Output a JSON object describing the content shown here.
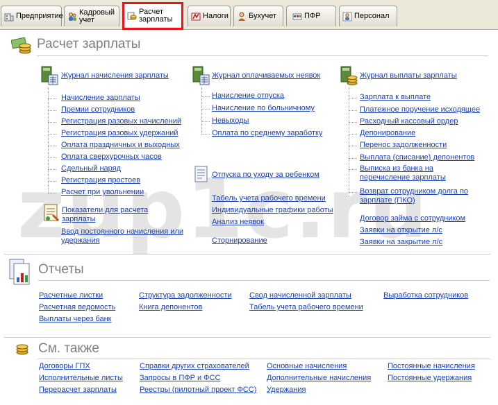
{
  "tabs": [
    {
      "label": "Предприятие",
      "icon": "building-icon"
    },
    {
      "label": "Кадровый\nучет",
      "icon": "people-icon"
    },
    {
      "label": "Расчет\nзарплаты",
      "icon": "coins-icon"
    },
    {
      "label": "Налоги",
      "icon": "tax-icon"
    },
    {
      "label": "Бухучет",
      "icon": "accountant-icon"
    },
    {
      "label": "ПФР",
      "icon": "pfr-icon"
    },
    {
      "label": "Персонал",
      "icon": "personnel-icon"
    }
  ],
  "watermark": "zup1c.ru",
  "payroll": {
    "heading": "Расчет зарплаты",
    "col1": {
      "journal": "Журнал начисления зарплаты",
      "items": [
        "Начисление зарплаты",
        "Премии сотрудников",
        "Регистрация разовых начислений",
        "Регистрация разовых удержаний",
        "Оплата праздничных и выходных",
        "Оплата сверхурочных часов",
        "Сдельный наряд",
        "Регистрация простоев",
        "Расчет при увольнении"
      ],
      "indicators": "Показатели для расчета зарплаты",
      "permanent": "Ввод постоянного начисления или удержания"
    },
    "col2": {
      "journal": "Журнал оплачиваемых неявок",
      "items": [
        "Начисление отпуска",
        "Начисление по больничному",
        "Невыходы",
        "Оплата по среднему заработку"
      ],
      "childcare": "Отпуска по уходу за ребенком",
      "links": [
        "Табель учета рабочего времени",
        "Индивидуальные графики работы",
        "Анализ неявок"
      ],
      "storno": "Сторнирование"
    },
    "col3": {
      "journal": "Журнал выплаты зарплаты",
      "items": [
        "Зарплата к выплате",
        "Платежное поручение исходящее",
        "Расходный кассовый ордер",
        "Депонирование",
        "Перенос задолженности",
        "Выплата (списание) депонентов",
        "Выписка из банка на перечисление зарплаты",
        "Возврат сотрудником долга по зарплате (ПКО)"
      ],
      "links": [
        "Договор займа с сотрудником",
        "Заявки на открытие л/с",
        "Заявки на закрытие л/с"
      ]
    }
  },
  "reports": {
    "heading": "Отчеты",
    "col1": [
      "Расчетные листки",
      "Расчетная ведомость",
      "Выплаты через банк"
    ],
    "col2": [
      "Структура задолженности",
      "Книга депонентов"
    ],
    "col3": [
      "Свод начисленной зарплаты",
      "Табель учета рабочего времени"
    ],
    "col4": [
      "Выработка сотрудников"
    ]
  },
  "see_also": {
    "heading": "См. также",
    "col1": [
      "Договоры ГПХ",
      "Исполнительные листы",
      "Перерасчет зарплаты"
    ],
    "col2": [
      "Справки других страхователей",
      "Запросы в ПФР и ФСС",
      "Реестры (пилотный проект ФСС)"
    ],
    "col3": [
      "Основные начисления",
      "Дополнительные начисления",
      "Удержания"
    ],
    "col4": [
      "Постоянные начисления",
      "Постоянные удержания"
    ]
  },
  "colors": {
    "accent_highlight": "#e8141b",
    "link": "#1a3fb0",
    "heading": "#7f7f7f"
  }
}
